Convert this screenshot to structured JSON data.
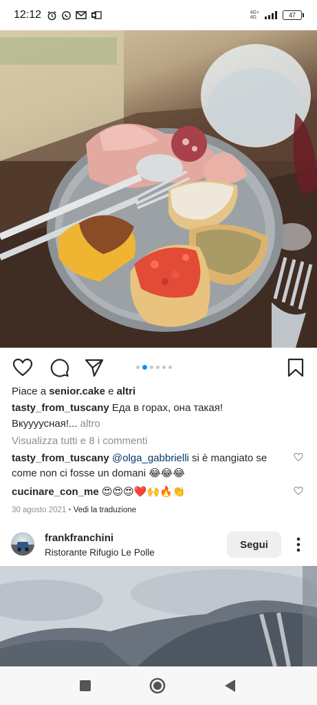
{
  "status_bar": {
    "time": "12:12",
    "network_top": "4G+",
    "network_bottom": "4G",
    "battery": "47"
  },
  "post": {
    "likes_prefix": "Piace a ",
    "likes_user": "senior.cake",
    "likes_middle": " e ",
    "likes_suffix": "altri",
    "caption_user": "tasty_from_tuscany",
    "caption_text": "Еда в горах, она такая!",
    "caption_line2": "Вкуууусная!...",
    "caption_more": "altro",
    "view_comments": "Visualizza tutti e 8 i commenti",
    "comments": [
      {
        "user": "tasty_from_tuscany",
        "mention": "@olga_gabbrielli",
        "text": "si è mangiato se",
        "text2": "come non ci fosse un domani 😂😂😂"
      },
      {
        "user": "cucinare_con_me",
        "text": "😍😍😍❤️🙌🔥👏"
      }
    ],
    "date": "30 agosto 2021",
    "separator": " • ",
    "translate": "Vedi la traduzione"
  },
  "next_post": {
    "username": "frankfranchini",
    "location": "Ristorante Rifugio Le Polle",
    "follow_label": "Segui"
  },
  "colors": {
    "accent_blue": "#0095f6",
    "text": "#262626",
    "muted": "#8e8e8e",
    "mention": "#00376b"
  },
  "icons": [
    "alarm-icon",
    "whatsapp-icon",
    "gmail-icon",
    "outlook-icon",
    "heart-icon",
    "comment-icon",
    "share-icon",
    "bookmark-icon",
    "more-icon",
    "nav-square-icon",
    "nav-home-icon",
    "nav-back-icon"
  ]
}
